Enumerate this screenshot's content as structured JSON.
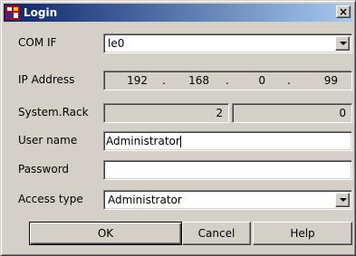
{
  "window": {
    "title": "Login",
    "close_glyph": "×",
    "icon": "app-icon"
  },
  "fields": {
    "com_if": {
      "label": "COM IF",
      "value": "le0"
    },
    "ip": {
      "label": "IP Address",
      "octets": [
        "192",
        "168",
        "0",
        "99"
      ],
      "separator": "."
    },
    "system_rack": {
      "label": "System.Rack",
      "system": "2",
      "rack": "0"
    },
    "user_name": {
      "label": "User name",
      "value": "Administrator"
    },
    "password": {
      "label": "Password",
      "value": ""
    },
    "access_type": {
      "label": "Access type",
      "value": "Administrator"
    }
  },
  "buttons": {
    "ok": "OK",
    "cancel": "Cancel",
    "help": "Help"
  }
}
